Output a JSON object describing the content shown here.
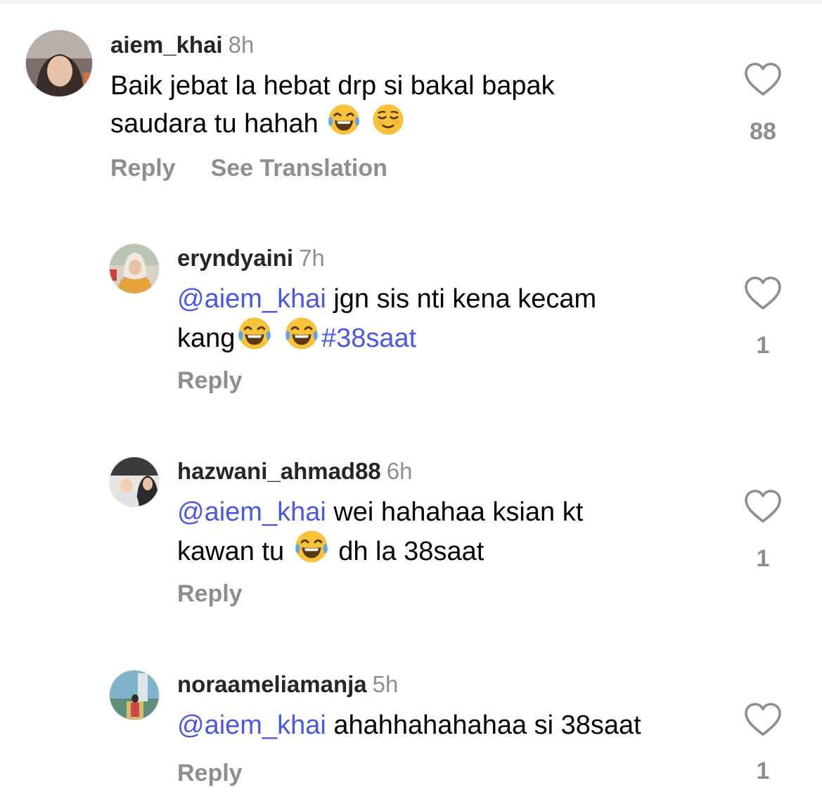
{
  "comments": [
    {
      "username": "aiem_khai",
      "time": "8h",
      "text_lines": [
        "Baik jebat la hebat drp si bakal bapak",
        "saudara tu hahah"
      ],
      "likes": "88",
      "reply_label": "Reply",
      "translation_label": "See Translation"
    },
    {
      "username": "eryndyaini",
      "time": "7h",
      "mention": "@aiem_khai",
      "text_line1": " jgn sis nti kena kecam",
      "text_line2": "kang",
      "hashtag": "#38saat",
      "likes": "1",
      "reply_label": "Reply"
    },
    {
      "username": "hazwani_ahmad88",
      "time": "6h",
      "mention": "@aiem_khai",
      "text_line1": " wei hahahaa ksian kt",
      "text_line2a": "kawan tu ",
      "text_line2b": " dh la 38saat",
      "likes": "1",
      "reply_label": "Reply"
    },
    {
      "username": "noraameliamanja",
      "time": "5h",
      "mention": "@aiem_khai",
      "text_line1": " ahahhahahahaa si 38saat",
      "likes": "1",
      "reply_label": "Reply"
    }
  ],
  "icons": {
    "like": "heart-outline-icon",
    "emoji_laugh": "face-with-tears-of-joy-icon",
    "emoji_relieved": "relieved-face-icon"
  },
  "colors": {
    "mention": "#4b58e6",
    "secondary_text": "#8e8e8e",
    "username": "#262626"
  }
}
